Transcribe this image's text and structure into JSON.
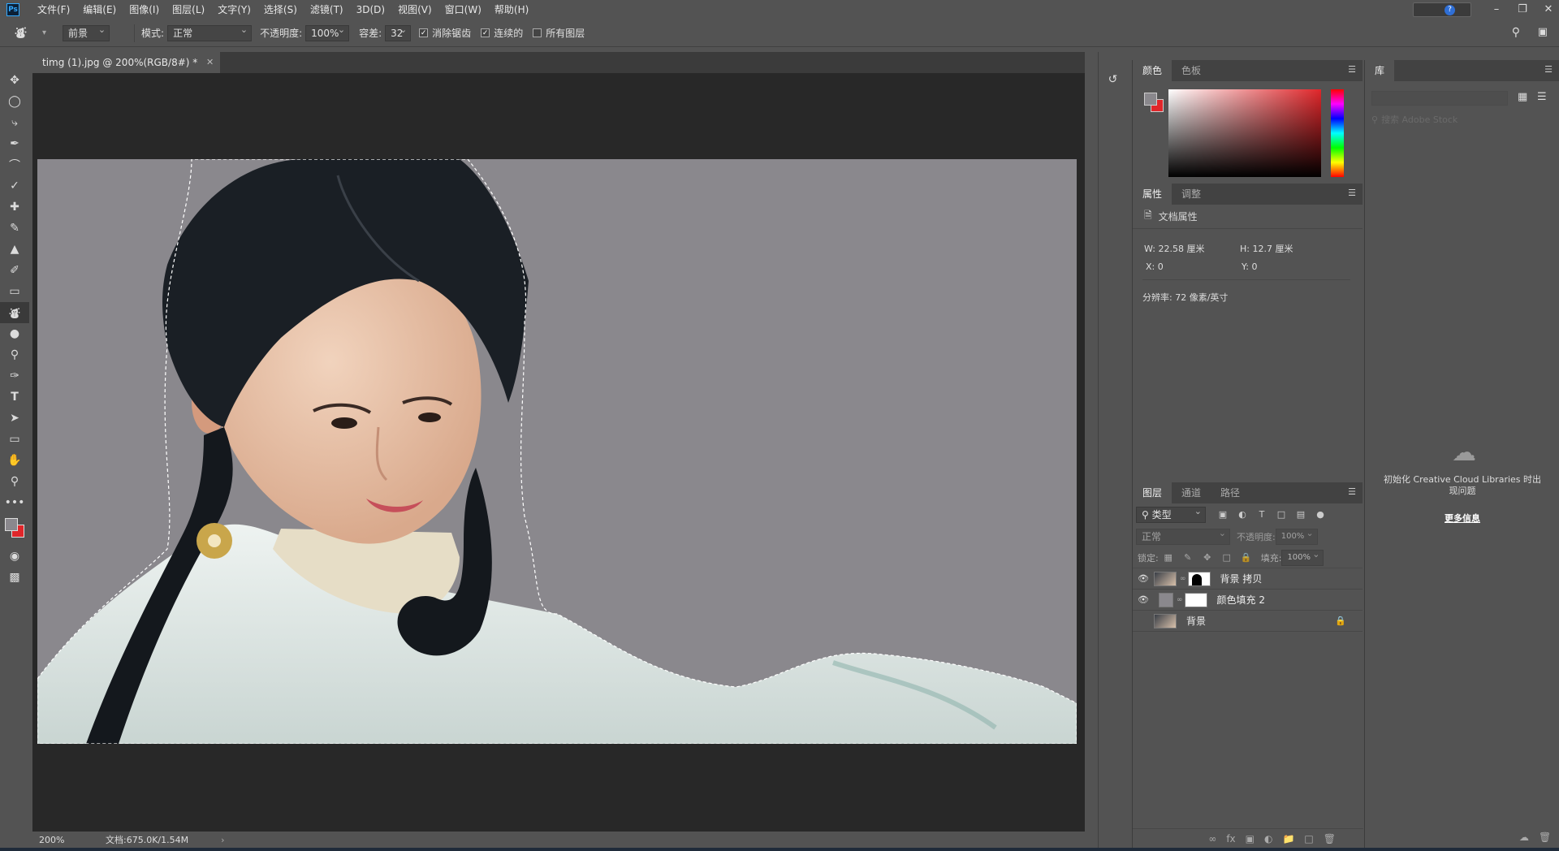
{
  "app": {
    "logo": "Ps",
    "accent": "#31a8ff"
  },
  "menu": [
    "文件(F)",
    "编辑(E)",
    "图像(I)",
    "图层(L)",
    "文字(Y)",
    "选择(S)",
    "滤镜(T)",
    "3D(D)",
    "视图(V)",
    "窗口(W)",
    "帮助(H)"
  ],
  "options": {
    "fill_source": "前景",
    "mode_label": "模式:",
    "mode_value": "正常",
    "opacity_label": "不透明度:",
    "opacity_value": "100%",
    "tolerance_label": "容差:",
    "tolerance_value": "32",
    "antialias_label": "消除锯齿",
    "antialias_checked": true,
    "contiguous_label": "连续的",
    "contiguous_checked": true,
    "all_layers_label": "所有图层",
    "all_layers_checked": false
  },
  "document": {
    "tab_title": "timg (1).jpg @ 200%(RGB/8#) *",
    "canvas_bg": "#8a888d",
    "zoom": "200%",
    "doc_info": "文档:675.0K/1.54M"
  },
  "color_panel": {
    "tabs": [
      "颜色",
      "色板"
    ],
    "foreground": "#8a888d",
    "background": "#e0262a"
  },
  "props_panel": {
    "tabs": [
      "属性",
      "调整"
    ],
    "header": "文档属性",
    "w_label": "W:",
    "w_value": "22.58 厘米",
    "h_label": "H:",
    "h_value": "12.7 厘米",
    "x_label": "X:",
    "x_value": "0",
    "y_label": "Y:",
    "y_value": "0",
    "resolution": "分辨率: 72 像素/英寸"
  },
  "layers_panel": {
    "tabs": [
      "图层",
      "通道",
      "路径"
    ],
    "filter_kind": "类型",
    "blend_mode": "正常",
    "opacity_label": "不透明度:",
    "opacity_value": "100%",
    "lock_label": "锁定:",
    "fill_label": "填充:",
    "fill_value": "100%",
    "layers": [
      {
        "name": "背景 拷贝",
        "visible": true
      },
      {
        "name": "颜色填充 2",
        "visible": true
      },
      {
        "name": "背景",
        "visible": false,
        "locked": true
      }
    ]
  },
  "library_panel": {
    "tab": "库",
    "search_placeholder": "搜索 Adobe Stock",
    "message": "初始化 Creative Cloud Libraries 时出现问题",
    "more_info": "更多信息"
  }
}
